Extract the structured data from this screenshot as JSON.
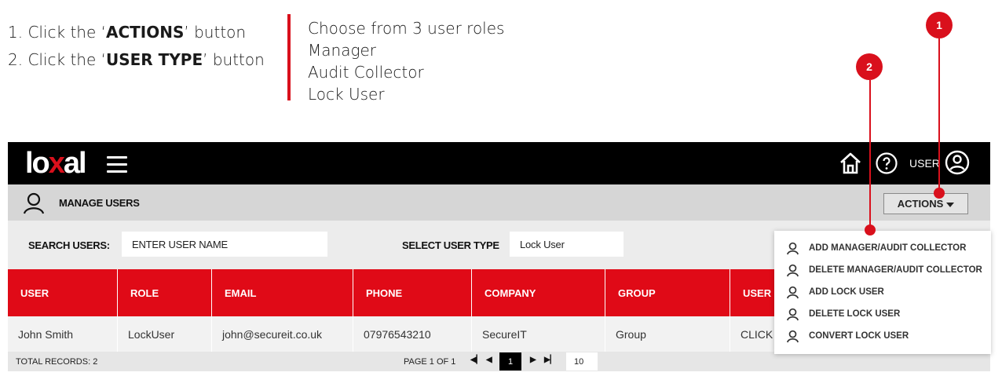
{
  "instructions": {
    "step1_prefix": "1. Click the ‘",
    "step1_bold": "ACTIONS",
    "step1_suffix": "’ button",
    "step2_prefix": "2. Click the ‘",
    "step2_bold": "USER TYPE",
    "step2_suffix": "’ button",
    "roles_heading": "Choose from 3 user roles",
    "roles": [
      "Manager",
      "Audit Collector",
      "Lock User"
    ]
  },
  "callouts": [
    "1",
    "2"
  ],
  "header": {
    "logo_pre": "lo",
    "logo_x": "x",
    "logo_post": "al",
    "user_label": "USER"
  },
  "subheader": {
    "title": "MANAGE USERS",
    "actions_label": "ACTIONS"
  },
  "search": {
    "search_label": "SEARCH USERS:",
    "search_placeholder": "ENTER USER NAME",
    "type_label": "SELECT USER TYPE",
    "type_value": "Lock User"
  },
  "table": {
    "columns": [
      "USER",
      "ROLE",
      "EMAIL",
      "PHONE",
      "COMPANY",
      "GROUP",
      "USER D"
    ],
    "rows": [
      [
        "John Smith",
        "LockUser",
        "john@secureit.co.uk",
        "07976543210",
        "SecureIT",
        "Group",
        "CLICK T"
      ]
    ]
  },
  "footer": {
    "total": "TOTAL RECORDS: 2",
    "page_text": "PAGE 1 OF 1",
    "current_page": "1",
    "page_size": "10"
  },
  "actions_menu": [
    "ADD MANAGER/AUDIT COLLECTOR",
    "DELETE MANAGER/AUDIT COLLECTOR",
    "ADD LOCK USER",
    "DELETE LOCK USER",
    "CONVERT LOCK USER"
  ],
  "colors": {
    "accent": "#d9101c",
    "header_bg": "#000000",
    "table_header": "#e00a17"
  }
}
